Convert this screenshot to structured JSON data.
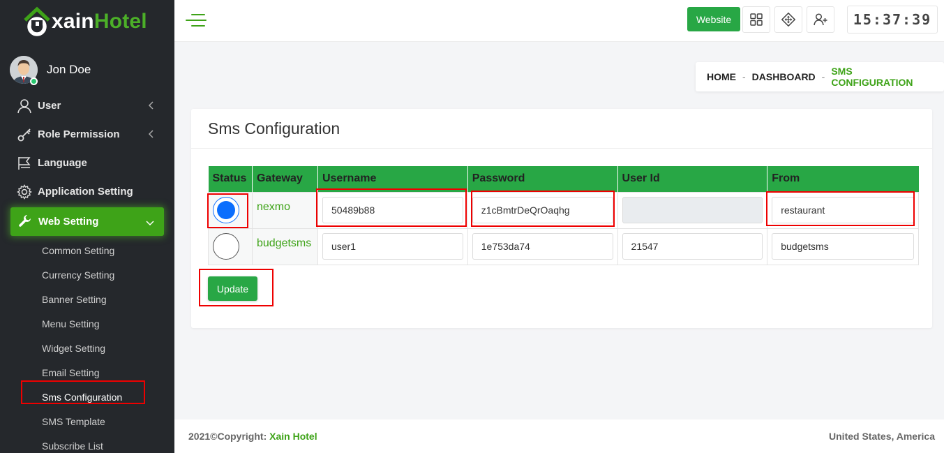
{
  "app": {
    "logo_part1": "xain",
    "logo_part2": "Hotel"
  },
  "colors": {
    "accent": "#3ea318",
    "button": "#28a745",
    "sidebar": "#25282c",
    "radio_selected": "#0b6efd",
    "highlight": "#e00000"
  },
  "profile": {
    "name": "Jon Doe",
    "status": "online"
  },
  "sidebar": {
    "items": [
      {
        "label": "User",
        "icon": "user-icon",
        "has_submenu": true
      },
      {
        "label": "Role Permission",
        "icon": "key-icon",
        "has_submenu": true
      },
      {
        "label": "Language",
        "icon": "language-icon",
        "has_submenu": false
      },
      {
        "label": "Application Setting",
        "icon": "gear-icon",
        "has_submenu": false
      },
      {
        "label": "Web Setting",
        "icon": "wrench-icon",
        "has_submenu": true,
        "active": true
      }
    ],
    "web_setting_sub": [
      "Common Setting",
      "Currency Setting",
      "Banner Setting",
      "Menu Setting",
      "Widget Setting",
      "Email Setting",
      "Sms Configuration",
      "SMS Template",
      "Subscribe List"
    ]
  },
  "topbar": {
    "website_label": "Website",
    "icons": [
      "grid-icon",
      "move-icon",
      "add-user-icon"
    ],
    "clock": "15:37:39"
  },
  "breadcrumb": {
    "home": "HOME",
    "dashboard": "DASHBOARD",
    "current": "SMS CONFIGURATION",
    "separator": "-"
  },
  "card": {
    "title": "Sms Configuration",
    "columns": [
      "Status",
      "Gateway",
      "Username",
      "Password",
      "User Id",
      "From"
    ],
    "rows": [
      {
        "selected": true,
        "gateway": "nexmo",
        "username": "50489b88",
        "password": "z1cBmtrDeQrOaqhg",
        "user_id": "",
        "user_id_disabled": true,
        "from": "restaurant"
      },
      {
        "selected": false,
        "gateway": "budgetsms",
        "username": "user1",
        "password": "1e753da74",
        "user_id": "21547",
        "user_id_disabled": false,
        "from": "budgetsms"
      }
    ],
    "update_label": "Update"
  },
  "footer": {
    "copyright": "2021©Copyright:",
    "brand": "Xain Hotel",
    "location": "United States, America"
  }
}
